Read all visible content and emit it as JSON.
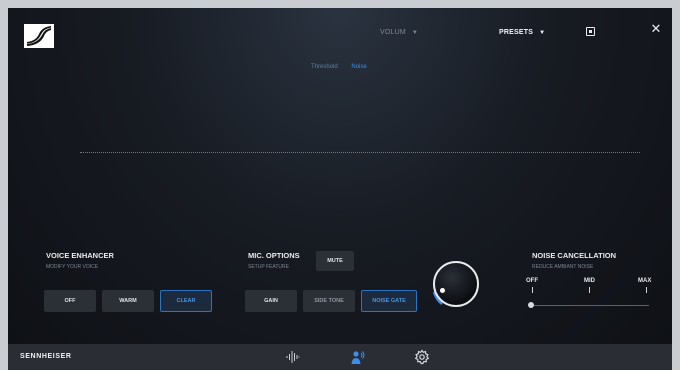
{
  "header": {
    "volume_label": "VOLUM",
    "presets_label": "PRESETS",
    "tabs": [
      "Threshold",
      "Noise"
    ]
  },
  "voice_enhancer": {
    "title": "VOICE ENHANCER",
    "subtitle": "MODIFY YOUR VOICE",
    "buttons": [
      "OFF",
      "WARM",
      "CLEAR"
    ],
    "selected": "CLEAR"
  },
  "mic_options": {
    "title": "MIC. OPTIONS",
    "subtitle": "SETUP FEATURE",
    "mute_label": "MUTE",
    "buttons": [
      "GAIN",
      "SIDE TONE",
      "NOISE GATE"
    ],
    "selected": "NOISE GATE"
  },
  "noise_cancellation": {
    "title": "NOISE CANCELLATION",
    "subtitle": "REDUCE AMBIANT NOISE",
    "levels": [
      "OFF",
      "MID",
      "MAX"
    ],
    "value_fraction": 0
  },
  "footer": {
    "brand": "SENNHEISER",
    "icons": [
      "equalizer-icon",
      "voice-icon",
      "settings-icon"
    ]
  },
  "colors": {
    "accent": "#3a8fe8",
    "background": "#0e1015",
    "footer": "#2a2d33"
  }
}
